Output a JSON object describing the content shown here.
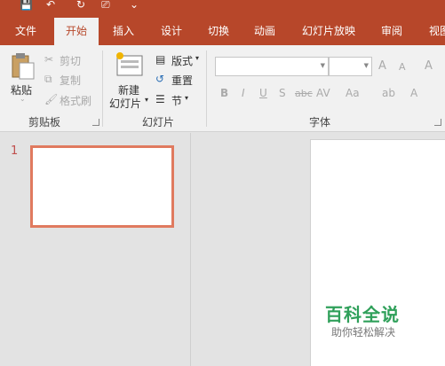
{
  "quick_access": {
    "save": "💾",
    "undo": "↶",
    "redo": "↻",
    "present": "⎚",
    "customize": "⌄"
  },
  "tabs": [
    "文件",
    "开始",
    "插入",
    "设计",
    "切换",
    "动画",
    "幻灯片放映",
    "审阅",
    "视图"
  ],
  "clipboard": {
    "paste": "粘贴",
    "cut": "剪切",
    "copy": "复制",
    "format_painter": "格式刷",
    "group": "剪贴板"
  },
  "slides_group": {
    "new_slide_line1": "新建",
    "new_slide_line2": "幻灯片",
    "layout": "版式",
    "reset": "重置",
    "section": "节",
    "group": "幻灯片"
  },
  "font_group": {
    "group": "字体",
    "bold": "B",
    "italic": "I",
    "underline": "U",
    "shadow": "S",
    "strike": "abc",
    "spacing": "AV",
    "case": "Aa",
    "highlight": "ab",
    "color": "A",
    "grow": "A",
    "shrink": "A",
    "clear": "A"
  },
  "slides_pane": {
    "slide_number": "1"
  },
  "watermark": {
    "title": "百科全说",
    "subtitle": "助你轻松解决"
  }
}
